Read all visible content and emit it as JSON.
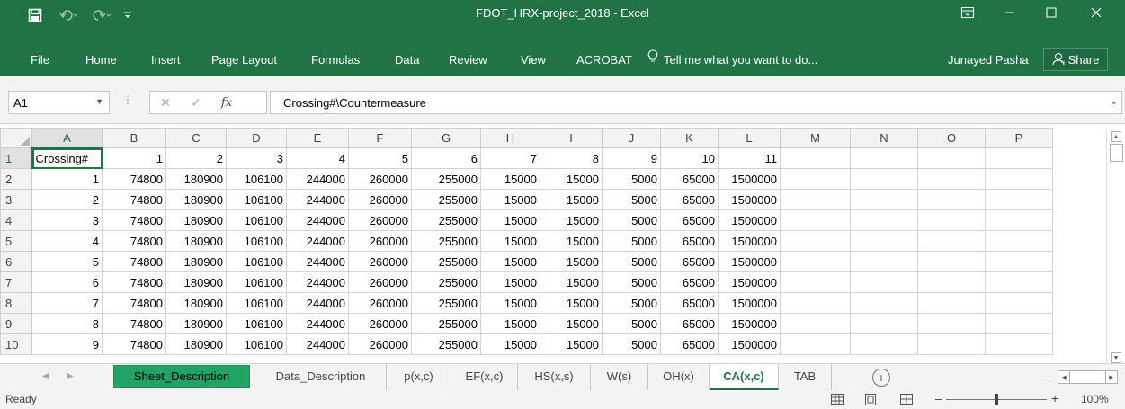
{
  "window": {
    "title": "FDOT_HRX-project_2018 - Excel"
  },
  "ribbon": {
    "tabs": [
      "File",
      "Home",
      "Insert",
      "Page Layout",
      "Formulas",
      "Data",
      "Review",
      "View",
      "ACROBAT"
    ],
    "tell_me": "Tell me what you want to do...",
    "user": "Junayed Pasha",
    "share": "Share"
  },
  "formula_bar": {
    "name_box": "A1",
    "formula": "Crossing#\\Countermeasure"
  },
  "grid": {
    "columns": [
      "A",
      "B",
      "C",
      "D",
      "E",
      "F",
      "G",
      "H",
      "I",
      "J",
      "K",
      "L",
      "M",
      "N",
      "O",
      "P"
    ],
    "rows": [
      {
        "num": "1",
        "cells": [
          "Crossing#",
          "1",
          "2",
          "3",
          "4",
          "5",
          "6",
          "7",
          "8",
          "9",
          "10",
          "11",
          "",
          "",
          "",
          ""
        ]
      },
      {
        "num": "2",
        "cells": [
          "1",
          "74800",
          "180900",
          "106100",
          "244000",
          "260000",
          "255000",
          "15000",
          "15000",
          "5000",
          "65000",
          "1500000",
          "",
          "",
          "",
          ""
        ]
      },
      {
        "num": "3",
        "cells": [
          "2",
          "74800",
          "180900",
          "106100",
          "244000",
          "260000",
          "255000",
          "15000",
          "15000",
          "5000",
          "65000",
          "1500000",
          "",
          "",
          "",
          ""
        ]
      },
      {
        "num": "4",
        "cells": [
          "3",
          "74800",
          "180900",
          "106100",
          "244000",
          "260000",
          "255000",
          "15000",
          "15000",
          "5000",
          "65000",
          "1500000",
          "",
          "",
          "",
          ""
        ]
      },
      {
        "num": "5",
        "cells": [
          "4",
          "74800",
          "180900",
          "106100",
          "244000",
          "260000",
          "255000",
          "15000",
          "15000",
          "5000",
          "65000",
          "1500000",
          "",
          "",
          "",
          ""
        ]
      },
      {
        "num": "6",
        "cells": [
          "5",
          "74800",
          "180900",
          "106100",
          "244000",
          "260000",
          "255000",
          "15000",
          "15000",
          "5000",
          "65000",
          "1500000",
          "",
          "",
          "",
          ""
        ]
      },
      {
        "num": "7",
        "cells": [
          "6",
          "74800",
          "180900",
          "106100",
          "244000",
          "260000",
          "255000",
          "15000",
          "15000",
          "5000",
          "65000",
          "1500000",
          "",
          "",
          "",
          ""
        ]
      },
      {
        "num": "8",
        "cells": [
          "7",
          "74800",
          "180900",
          "106100",
          "244000",
          "260000",
          "255000",
          "15000",
          "15000",
          "5000",
          "65000",
          "1500000",
          "",
          "",
          "",
          ""
        ]
      },
      {
        "num": "9",
        "cells": [
          "8",
          "74800",
          "180900",
          "106100",
          "244000",
          "260000",
          "255000",
          "15000",
          "15000",
          "5000",
          "65000",
          "1500000",
          "",
          "",
          "",
          ""
        ]
      },
      {
        "num": "10",
        "cells": [
          "9",
          "74800",
          "180900",
          "106100",
          "244000",
          "260000",
          "255000",
          "15000",
          "15000",
          "5000",
          "65000",
          "1500000",
          "",
          "",
          "",
          ""
        ]
      }
    ]
  },
  "sheets": [
    "Sheet_Description",
    "Data_Description",
    "p(x,c)",
    "EF(x,c)",
    "HS(x,s)",
    "W(s)",
    "OH(x)",
    "CA(x,c)",
    "TAB"
  ],
  "active_sheet": "CA(x,c)",
  "status": {
    "ready": "Ready",
    "zoom": "100%"
  },
  "colors": {
    "excel_green": "#217346",
    "highlight_tab": "#21a366"
  }
}
